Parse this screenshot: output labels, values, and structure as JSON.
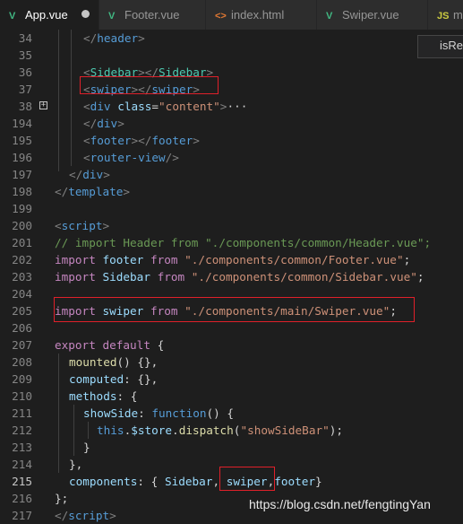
{
  "tabs": [
    {
      "label": "App.vue",
      "icon": "vue-icon",
      "active": true,
      "modified": true
    },
    {
      "label": "Footer.vue",
      "icon": "vue-icon"
    },
    {
      "label": "index.html",
      "icon": "html-icon"
    },
    {
      "label": "Swiper.vue",
      "icon": "vue-icon"
    },
    {
      "label": "ma",
      "icon": "js-icon"
    }
  ],
  "tab_icons": {
    "vue": "V",
    "html": "<>",
    "js": "JS"
  },
  "hint": {
    "label": "isRel"
  },
  "gutter": {
    "fold_glyph": "+"
  },
  "line_numbers": [
    "34",
    "35",
    "36",
    "37",
    "38",
    "194",
    "195",
    "196",
    "197",
    "198",
    "199",
    "200",
    "201",
    "202",
    "203",
    "204",
    "205",
    "206",
    "207",
    "208",
    "209",
    "210",
    "211",
    "212",
    "213",
    "214",
    "215",
    "216",
    "217"
  ],
  "current_line": "215",
  "code": {
    "l34": [
      "</",
      "header",
      ">"
    ],
    "l36": [
      "<",
      "Sidebar",
      "></",
      "Sidebar",
      ">"
    ],
    "l37": [
      "<",
      "swiper",
      "></",
      "swiper",
      ">"
    ],
    "l38": [
      "<",
      "div",
      " ",
      "class",
      "=",
      "\"content\"",
      ">",
      "···"
    ],
    "l194": [
      "</",
      "div",
      ">"
    ],
    "l195": [
      "<",
      "footer",
      "></",
      "footer",
      ">"
    ],
    "l196": [
      "<",
      "router-view",
      "/>"
    ],
    "l197": [
      "</",
      "div",
      ">"
    ],
    "l198": [
      "</",
      "template",
      ">"
    ],
    "l200": [
      "<",
      "script",
      ">"
    ],
    "l201": "// import Header from \"./components/common/Header.vue\";",
    "l202": [
      "import",
      " footer ",
      "from",
      " ",
      "\"./components/common/Footer.vue\"",
      ";"
    ],
    "l203": [
      "import",
      " Sidebar ",
      "from",
      " ",
      "\"./components/common/Sidebar.vue\"",
      ";"
    ],
    "l205": [
      "import",
      " swiper ",
      "from",
      " ",
      "\"./components/main/Swiper.vue\"",
      ";"
    ],
    "l207": [
      "export",
      " ",
      "default",
      " {"
    ],
    "l208": [
      "mounted",
      "() {},"
    ],
    "l209": [
      "computed",
      ": {},"
    ],
    "l210": [
      "methods",
      ": {"
    ],
    "l211": [
      "showSide",
      ": ",
      "function",
      "() {"
    ],
    "l212": [
      "this",
      ".",
      "$store",
      ".",
      "dispatch",
      "(",
      "\"showSideBar\"",
      ");"
    ],
    "l213": "}",
    "l214": "},",
    "l215": [
      "components",
      ": { ",
      "Sidebar",
      ", ",
      "swiper",
      ",",
      "footer",
      "}"
    ],
    "l216": "};",
    "l217": [
      "</",
      "script",
      ">"
    ]
  },
  "watermark": "https://blog.csdn.net/fengtingYan",
  "colors": {
    "background": "#1e1e1e",
    "tabbar": "#252526",
    "highlight_box": "#e0202a",
    "tag": "#569cd6",
    "string": "#ce9178",
    "keyword": "#c586c0",
    "comment": "#6a9955",
    "property": "#9cdcfe",
    "function": "#dcdcaa"
  }
}
